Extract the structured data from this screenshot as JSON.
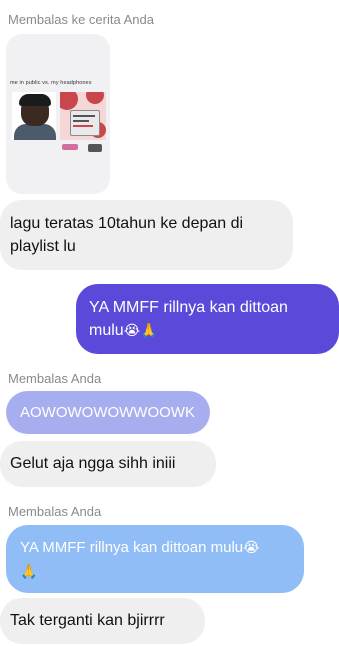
{
  "thread": {
    "story_reply_label": "Membalas ke cerita Anda",
    "story": {
      "caption": "me in public vs. my headphones"
    },
    "messages": [
      {
        "id": "m1",
        "lines": [
          "lagu teratas 10tahun ke depan di",
          "playlist lu"
        ]
      },
      {
        "id": "m2",
        "lines": [
          "YA MMFF rillnya kan dittoan",
          "mulu"
        ],
        "emoji": "😭🙏"
      },
      {
        "id": "m3",
        "reply_label": "Membalas Anda",
        "quoted": "AOWOWOWOWWOOWK",
        "text": "Gelut aja ngga sihh iniii"
      },
      {
        "id": "m4",
        "reply_label": "Membalas Anda",
        "quoted_lines": [
          "YA MMFF rillnya kan dittoan mulu",
          ""
        ],
        "quoted_emoji_1": "😭",
        "quoted_emoji_2": "🙏",
        "text": "Tak terganti kan bjirrrr"
      }
    ]
  },
  "colors": {
    "sent_bubble": "#5b49d9",
    "received_bubble": "#efefef",
    "quoted_lavender": "#a7aef0",
    "quoted_sky": "#90bdf5"
  }
}
